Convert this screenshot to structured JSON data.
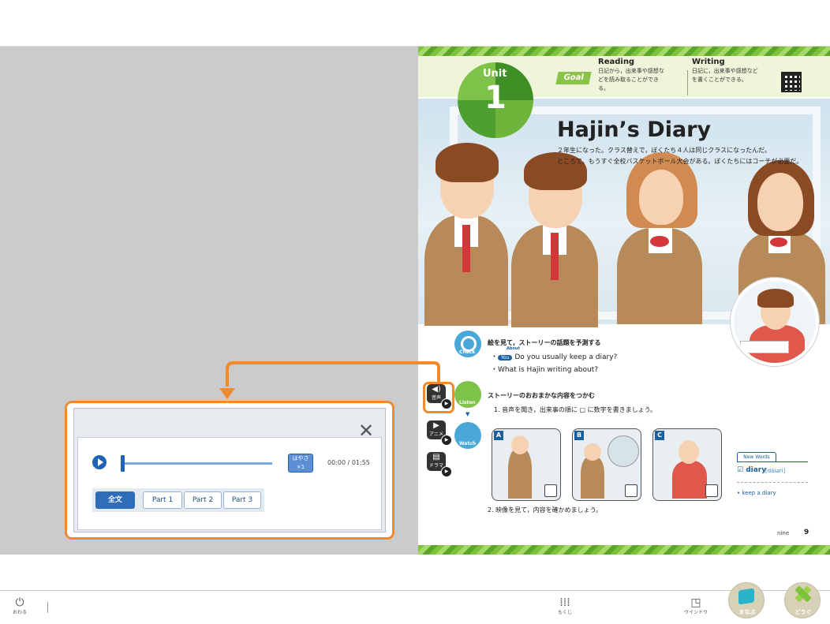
{
  "textbook": {
    "unit": {
      "word": "Unit",
      "number": "1"
    },
    "goal": {
      "badge": "Goal",
      "reading_title": "Reading",
      "reading_text": "日記から，出来事や感想などを読み取ることができる。",
      "writing_title": "Writing",
      "writing_text": "日記に，出来事や感想などを書くことができる。"
    },
    "title": "Hajin’s Diary",
    "intro_line1": "２年生になった。クラス替えで，ぼくたち４人は同じクラスになったんだ。",
    "intro_line2": "ところで，もうすぐ全校バスケットボール大会がある。ぼくたちにはコーチが必要だ。",
    "check": {
      "icon_label": "Check",
      "heading": "絵を見て，ストーリーの話題を予測する",
      "you_tag": "You",
      "about_tag": "About",
      "q1": "Do you usually keep a diary?",
      "q2": "・What is Hajin writing about?"
    },
    "listen": {
      "icon_label": "Listen",
      "heading": "ストーリーのおおまかな内容をつかむ",
      "instruction1": "1. 音声を聞き，出来事の順に ▢ に数字を書きましょう。",
      "instruction2": "2. 映像を見て，内容を確かめましょう。"
    },
    "watch_label": "Watch",
    "media_buttons": {
      "audio": "音声",
      "anime": "アニメ",
      "drama": "ドラマ"
    },
    "scenes": [
      "A",
      "B",
      "C"
    ],
    "new_words": {
      "tab": "New Words",
      "word": "☑ diary",
      "pron": "[dáiəri]",
      "item": "• keep a diary"
    },
    "page_word": "nine",
    "page_number": "9"
  },
  "player": {
    "speed_label_top": "はやさ",
    "speed_label_bottom": "×1",
    "time": "00:00 / 01:55",
    "progress": 0,
    "segments": [
      "全文",
      "Part 1",
      "Part 2",
      "Part 3"
    ],
    "active_segment": "全文"
  },
  "bottombar": {
    "quit": "おわる",
    "contents": "もくじ",
    "window": "ウインドウ",
    "learn": "まなぶ",
    "tools": "どうぐ"
  },
  "colors": {
    "accent_orange": "#f08a2a",
    "primary_blue": "#1f63b4",
    "unit_green": "#6fb43a"
  }
}
